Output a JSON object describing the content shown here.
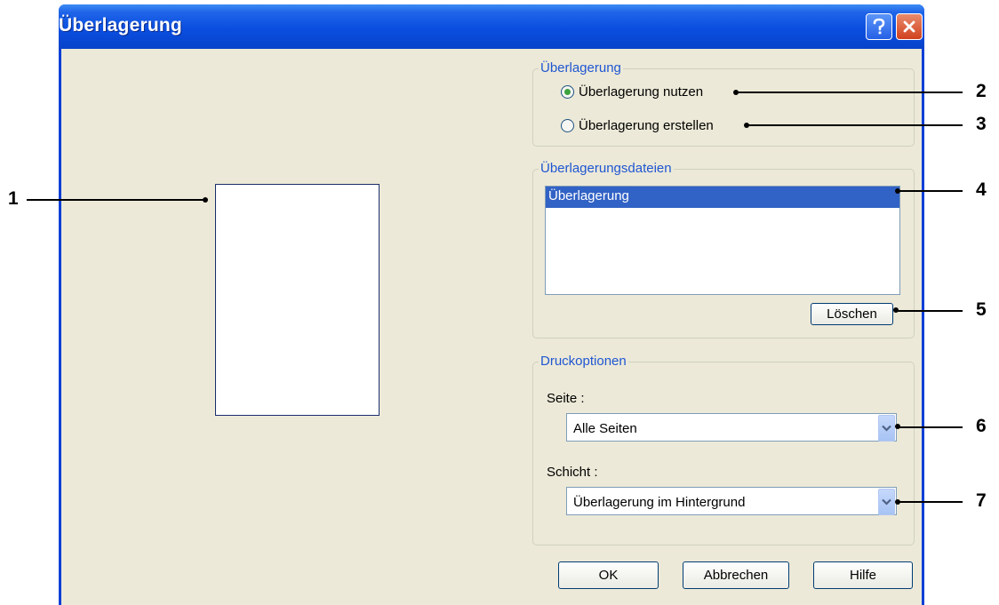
{
  "window": {
    "title": "Überlagerung"
  },
  "overlay_group": {
    "legend": "Überlagerung",
    "option_use": "Überlagerung nutzen",
    "option_create": "Überlagerung erstellen",
    "selected": "option_use"
  },
  "files_group": {
    "legend": "Überlagerungsdateien",
    "items": [
      "Überlagerung"
    ],
    "delete_button": "Löschen"
  },
  "print_options": {
    "legend": "Druckoptionen",
    "page_label": "Seite :",
    "page_value": "Alle Seiten",
    "layer_label": "Schicht :",
    "layer_value": "Überlagerung im Hintergrund"
  },
  "buttons": {
    "ok": "OK",
    "cancel": "Abbrechen",
    "help": "Hilfe"
  },
  "callouts": [
    "1",
    "2",
    "3",
    "4",
    "5",
    "6",
    "7"
  ],
  "colors": {
    "title_bar": "#0a4ee0",
    "dialog_bg": "#ece9d8",
    "legend_text": "#1f56d2",
    "selection": "#3162c5",
    "close_button": "#d1411d"
  }
}
